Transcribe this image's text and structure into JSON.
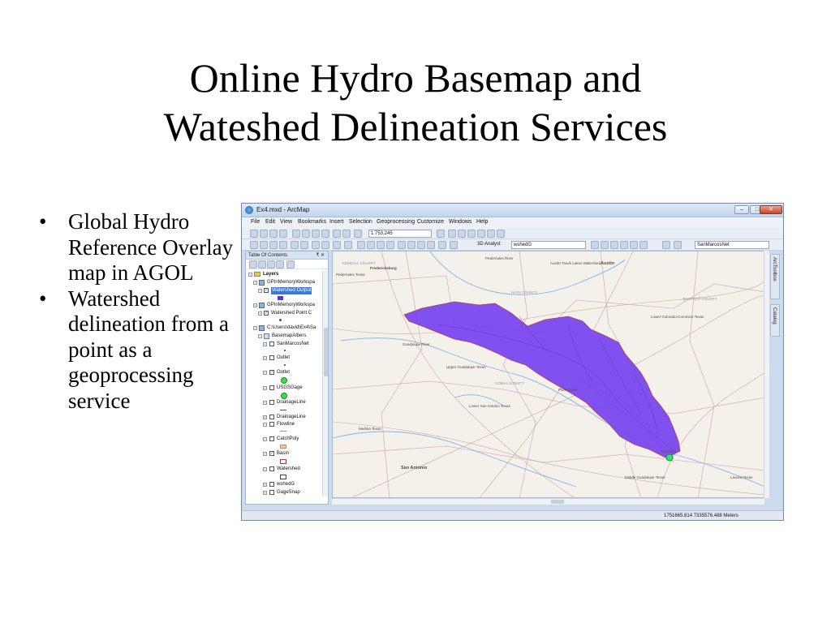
{
  "slide": {
    "title_line1": "Online Hydro Basemap and",
    "title_line2": "Wateshed Delineation Services",
    "bullets": [
      "Global Hydro Reference Overlay map in AGOL",
      "Watershed delineation from a point as a geoprocessing service"
    ]
  },
  "window": {
    "title": "Ex4.mxd - ArcMap",
    "buttons": {
      "minimize": "–",
      "maximize": "□",
      "close": "✕"
    }
  },
  "menu": [
    "File",
    "Edit",
    "View",
    "Bookmarks",
    "Insert",
    "Selection",
    "Geoprocessing",
    "Customize",
    "Windows",
    "Help"
  ],
  "toolbar": {
    "scale": "1:753,245",
    "analyst": "3D Analyst",
    "layer_dropdown": "wshedG",
    "network_dropdown": "SanMarcosNet"
  },
  "toc": {
    "title": "Table Of Contents",
    "pin": "₹ ✕",
    "rows": [
      "Layers",
      "GPInMemoryWorkspa",
      "Watershed Output",
      "GPInMemoryWorkspa",
      "Watershed Point C",
      "C:\\Users\\david\\Ex4\\Sa",
      "BasemapAlbers",
      "SanMarcosNet",
      "Outlet",
      "Outlet",
      "USGSGage",
      "DrainageLine",
      "DrainageLine",
      "Flowline",
      "CatchPoly",
      "Basin",
      "Watershed",
      "wshedG",
      "GageSnap"
    ]
  },
  "map_labels": {
    "a": "Pedernales River",
    "b": "Austin-Travis Lakes Watershed",
    "c": "Austin",
    "d": "Pedernales Texas",
    "e": "Fredericksburg",
    "f": "HAYS COUNTY",
    "g": "BASTROP COUNTY",
    "h": "Lower Colorado-Cummins Texas",
    "i": "COMAL COUNTY",
    "j": "Guadalupe River",
    "k": "Upper Guadalupe Texas",
    "l": "San Antonio",
    "m": "Medina Texas",
    "n": "Lower San Antonio Texas",
    "o": "Middle Guadalupe Texas",
    "p": "Gonzales",
    "q": "Lavaca Texas",
    "r": "KENDALL COUNTY",
    "s": "Plum Creek"
  },
  "colors": {
    "basin_fill": "#7b49f0",
    "basin_stroke": "#b0334a",
    "outlet": "#35e07a",
    "map_bg": "#f4f1ea",
    "selection": "#3b78d8"
  },
  "status": {
    "coordinates": "1751665.814  7335576.488 Meters"
  },
  "side_tabs": [
    "ArcToolbox",
    "Catalog"
  ]
}
